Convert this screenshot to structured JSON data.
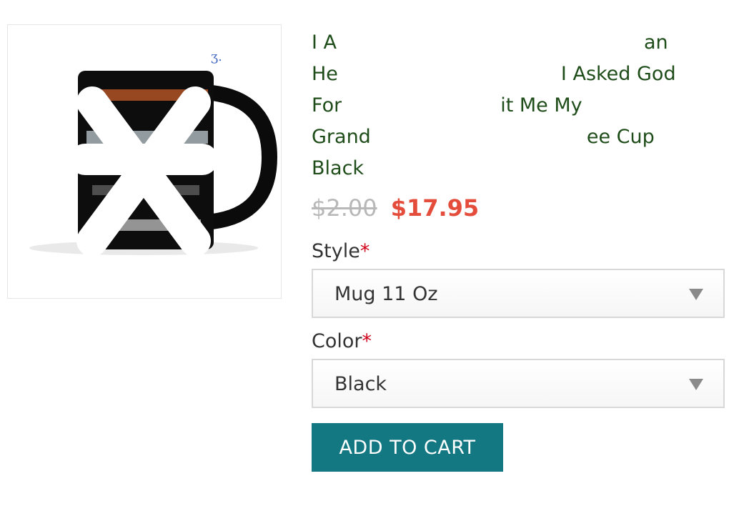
{
  "product": {
    "title_lines": [
      {
        "left": "I A",
        "right": "an"
      },
      {
        "left": "He",
        "right": "I Asked God"
      },
      {
        "left": "For",
        "right": "it Me My"
      },
      {
        "left": "Grand",
        "right": "ee Cup"
      },
      {
        "left": "Black",
        "right": ""
      }
    ],
    "old_price": "$2.00",
    "price": "$17.95"
  },
  "options": {
    "style": {
      "label": "Style",
      "required_mark": "*",
      "selected": "Mug 11 Oz"
    },
    "color": {
      "label": "Color",
      "required_mark": "*",
      "selected": "Black"
    }
  },
  "actions": {
    "add_to_cart": "ADD TO CART"
  },
  "colors": {
    "title": "#1f4d1a",
    "price": "#e44d3b",
    "button": "#137881",
    "required": "#d0021b"
  }
}
